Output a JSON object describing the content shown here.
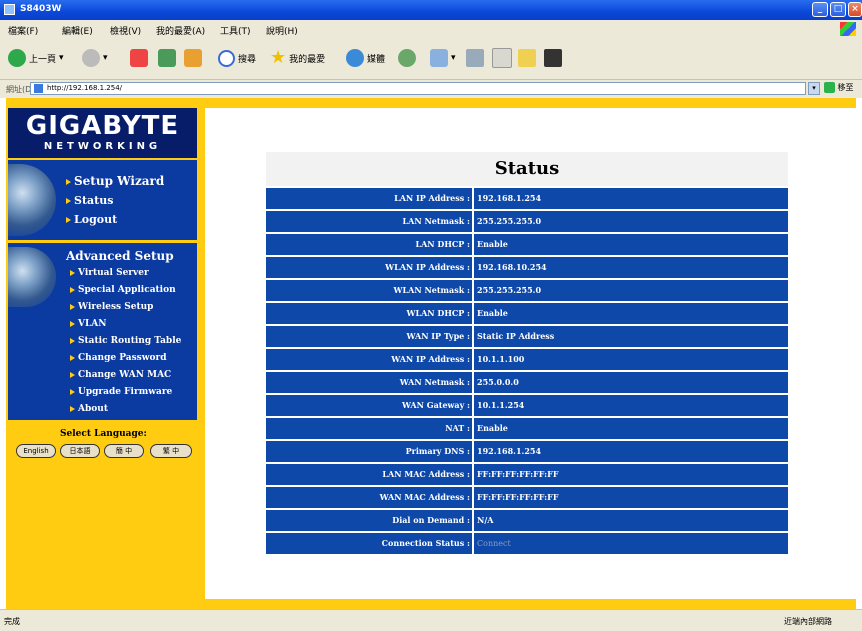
{
  "window": {
    "title": "S8403W"
  },
  "menu": [
    "檔案(F)",
    "編輯(E)",
    "檢視(V)",
    "我的最愛(A)",
    "工具(T)",
    "說明(H)"
  ],
  "toolbar": {
    "back": "上一頁",
    "search": "搜尋",
    "favorites": "我的最愛",
    "media": "媒體"
  },
  "address": {
    "label": "網址(D)",
    "url": "http://192.168.1.254/",
    "go": "移至"
  },
  "brand": {
    "name": "GIGABYTE",
    "sub": "NETWORKING"
  },
  "nav_main": [
    "Setup Wizard",
    "Status",
    "Logout"
  ],
  "advanced": {
    "title": "Advanced Setup",
    "items": [
      "Virtual Server",
      "Special Application",
      "Wireless Setup",
      "VLAN",
      "Static Routing Table",
      "Change Password",
      "Change WAN MAC",
      "Upgrade Firmware",
      "About"
    ]
  },
  "language": {
    "label": "Select Language:",
    "options": [
      "English",
      "日本語",
      "簡 中",
      "繁 中"
    ]
  },
  "status": {
    "title": "Status",
    "rows": [
      {
        "label": "LAN IP Address :",
        "value": "192.168.1.254"
      },
      {
        "label": "LAN Netmask :",
        "value": "255.255.255.0"
      },
      {
        "label": "LAN DHCP :",
        "value": "Enable"
      },
      {
        "label": "WLAN IP Address :",
        "value": "192.168.10.254"
      },
      {
        "label": "WLAN Netmask :",
        "value": "255.255.255.0"
      },
      {
        "label": "WLAN DHCP :",
        "value": "Enable"
      },
      {
        "label": "WAN IP Type :",
        "value": "Static IP Address"
      },
      {
        "label": "WAN IP Address :",
        "value": "10.1.1.100"
      },
      {
        "label": "WAN Netmask :",
        "value": "255.0.0.0"
      },
      {
        "label": "WAN Gateway :",
        "value": "10.1.1.254"
      },
      {
        "label": "NAT :",
        "value": "Enable"
      },
      {
        "label": "Primary DNS :",
        "value": "192.168.1.254"
      },
      {
        "label": "LAN MAC Address :",
        "value": "FF:FF:FF:FF:FF:FF"
      },
      {
        "label": "WAN MAC Address :",
        "value": "FF:FF:FF:FF:FF:FF"
      },
      {
        "label": "Dial on Demand :",
        "value": "N/A"
      },
      {
        "label": "Connection Status :",
        "value": "Connect"
      }
    ]
  },
  "statusbar": {
    "left": "完成",
    "right": "近端內部網路"
  },
  "colors": {
    "nav_blue": "#0b3aa0",
    "row_blue": "#0e48a8",
    "accent_yellow": "#ffcc11"
  }
}
